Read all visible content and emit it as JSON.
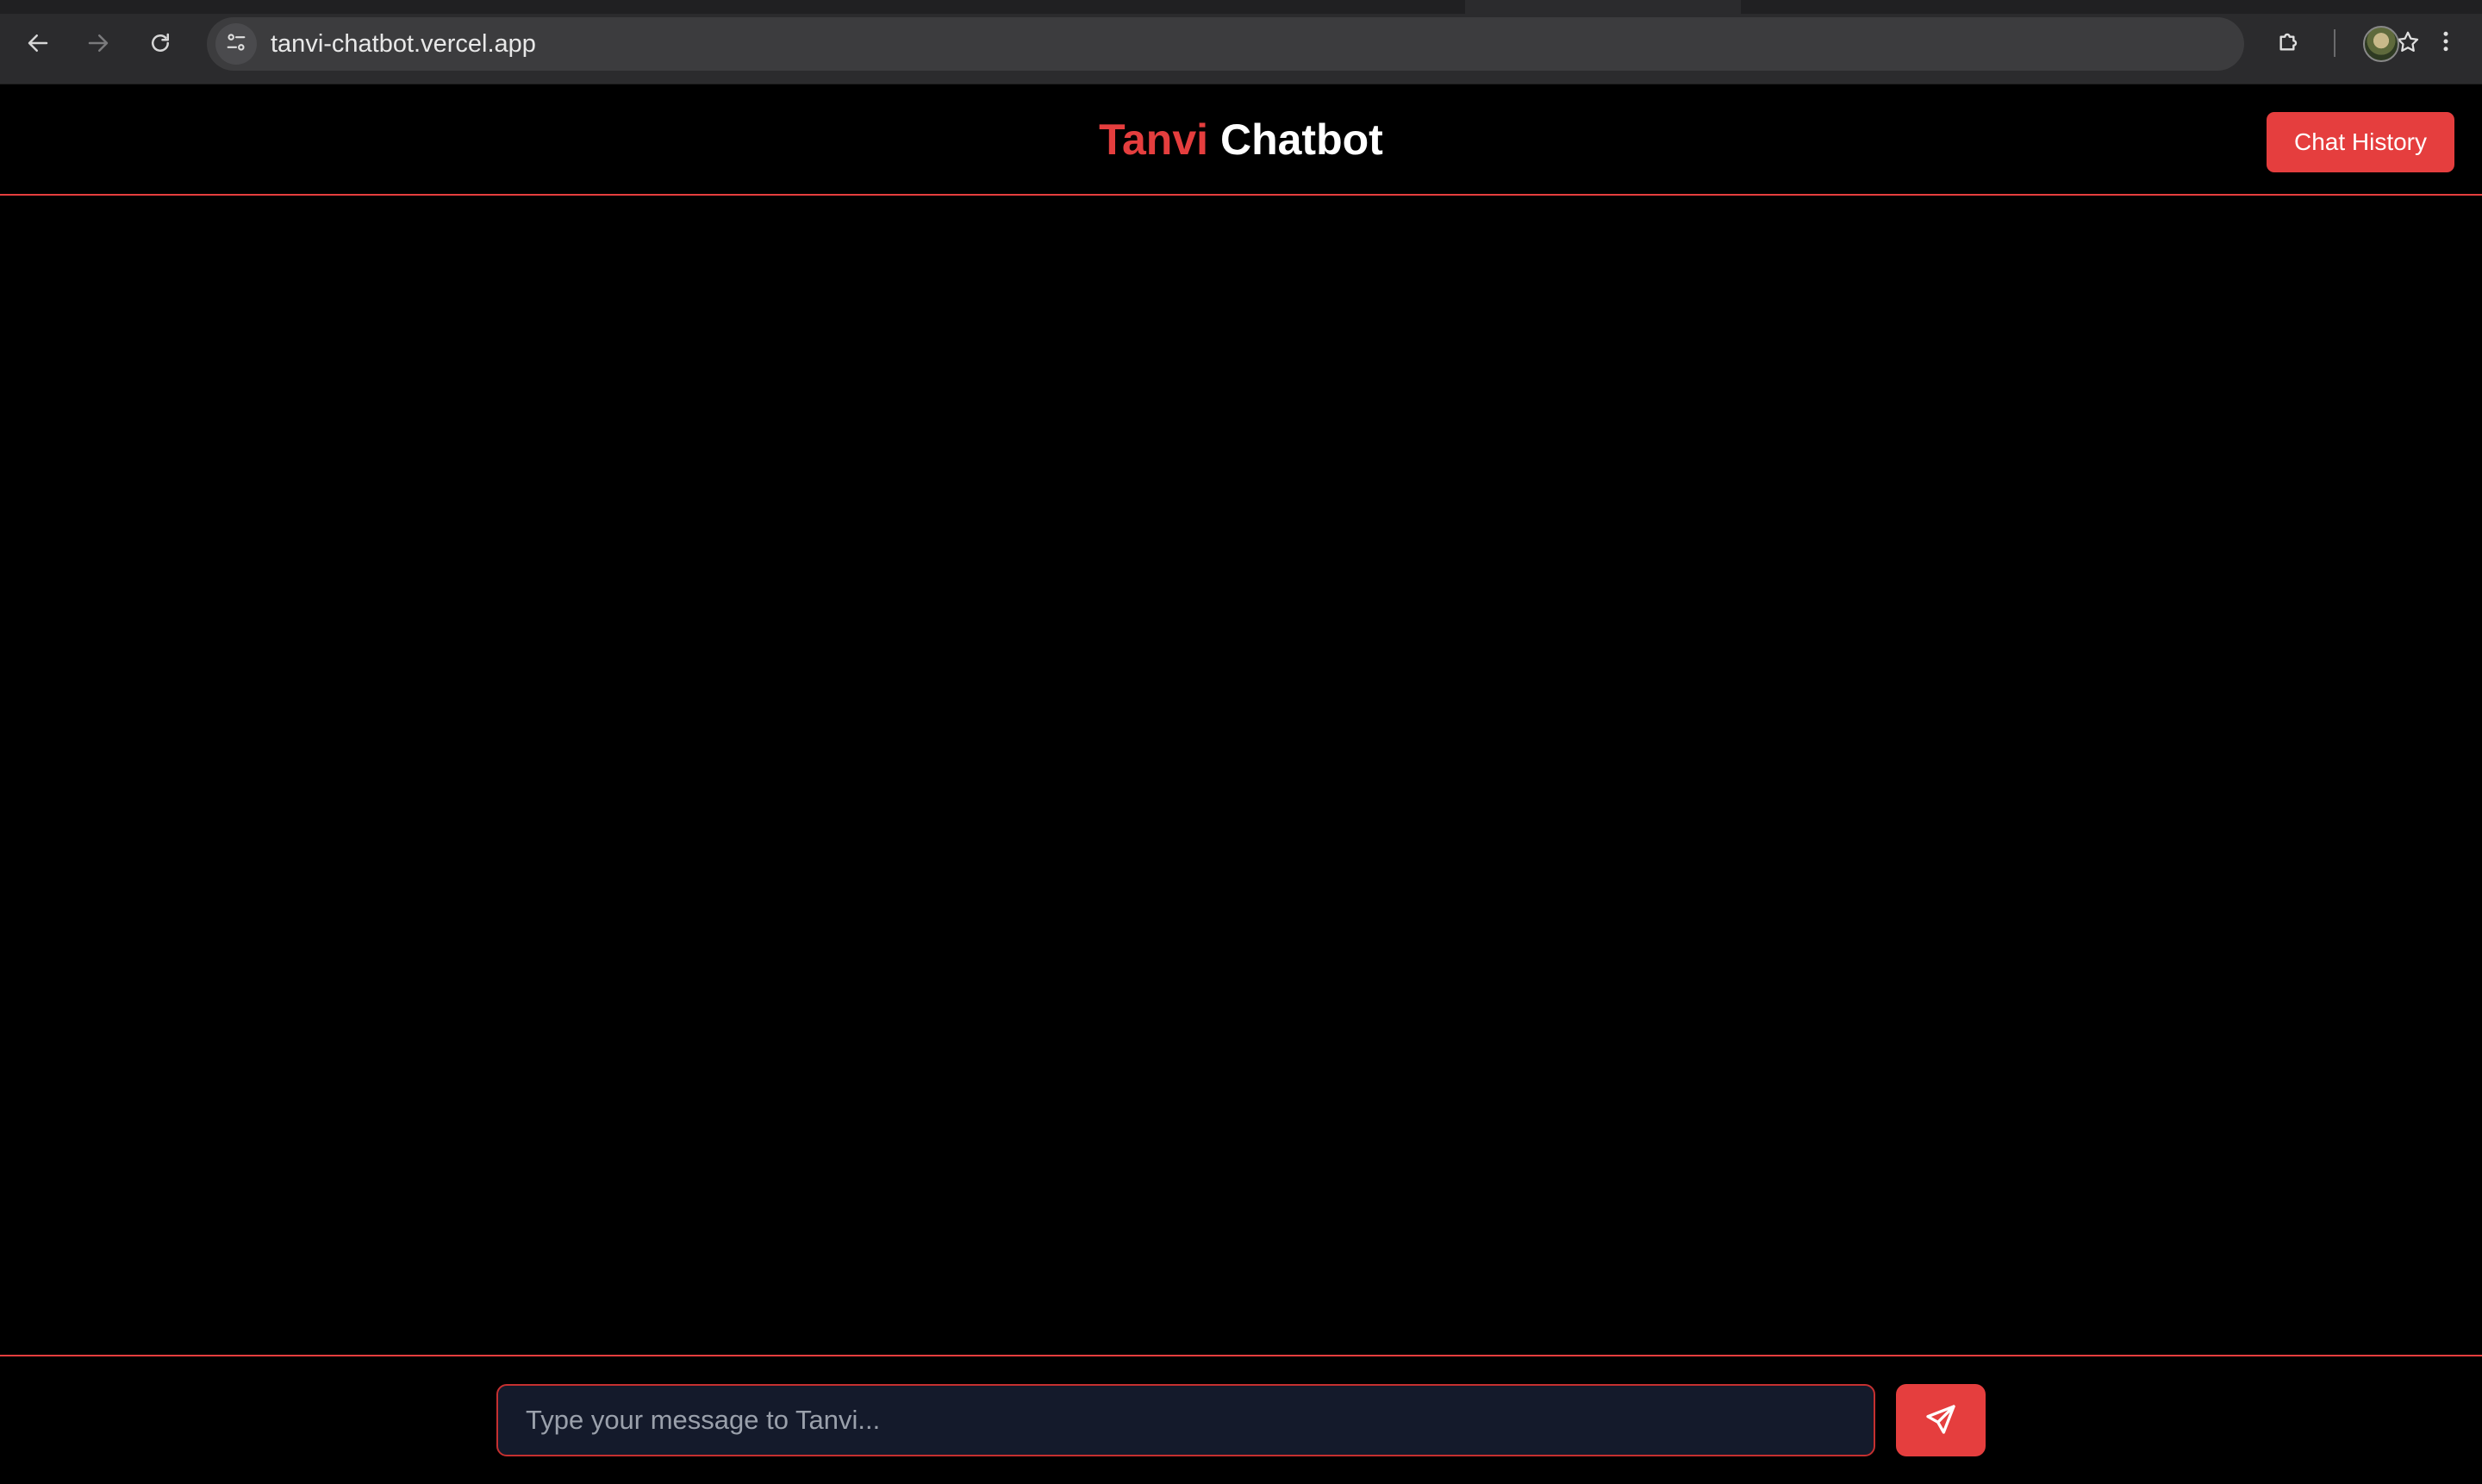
{
  "browser": {
    "url": "tanvi-chatbot.vercel.app",
    "icons": {
      "back": "back-arrow-icon",
      "forward": "forward-arrow-icon",
      "reload": "reload-icon",
      "site_info": "site-settings-icon",
      "bookmark": "star-icon",
      "extensions": "puzzle-icon",
      "profile": "avatar",
      "menu": "kebab-menu-icon"
    }
  },
  "header": {
    "title_accent": "Tanvi",
    "title_rest": "Chatbot",
    "history_button_label": "Chat History"
  },
  "composer": {
    "input_value": "",
    "input_placeholder": "Type your message to Tanvi...",
    "send_icon": "send-icon"
  },
  "colors": {
    "accent": "#e53e3e",
    "background": "#000000",
    "input_background": "#141a2b",
    "browser_chrome": "#2b2b2d"
  }
}
